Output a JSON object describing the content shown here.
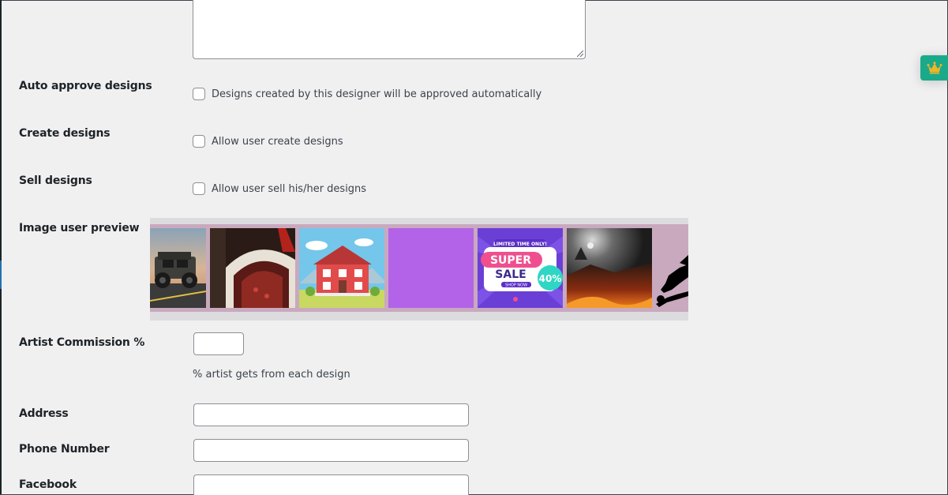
{
  "fields": {
    "auto_approve": {
      "label": "Auto approve designs",
      "checkbox_text": "Designs created by this designer will be approved automatically",
      "checked": false
    },
    "create_designs": {
      "label": "Create designs",
      "checkbox_text": "Allow user create designs",
      "checked": false
    },
    "sell_designs": {
      "label": "Sell designs",
      "checkbox_text": "Allow user sell his/her designs",
      "checked": false
    },
    "image_preview": {
      "label": "Image user preview",
      "images": [
        "jeep-image",
        "red-curtain-image",
        "red-house-image",
        "purple-swatch",
        "super-sale-image",
        "halloween-night-image",
        "witch-silhouette-image"
      ]
    },
    "artist_commission": {
      "label": "Artist Commission %",
      "value": "",
      "help": "% artist gets from each design"
    },
    "address": {
      "label": "Address",
      "value": ""
    },
    "phone": {
      "label": "Phone Number",
      "value": ""
    },
    "facebook": {
      "label": "Facebook",
      "value": ""
    }
  },
  "sale_banner": {
    "top": "LIMITED TIME ONLY!",
    "line1": "SUPER",
    "line2": "SALE",
    "badge": "40%",
    "cta": "SHOP NOW"
  },
  "colors": {
    "page_bg": "#f0f0f1",
    "accent_tab": "#1aaa8a",
    "crown": "#f0b429",
    "gallery_strip": "#c9a9be",
    "purple_swatch": "#b263e8"
  }
}
